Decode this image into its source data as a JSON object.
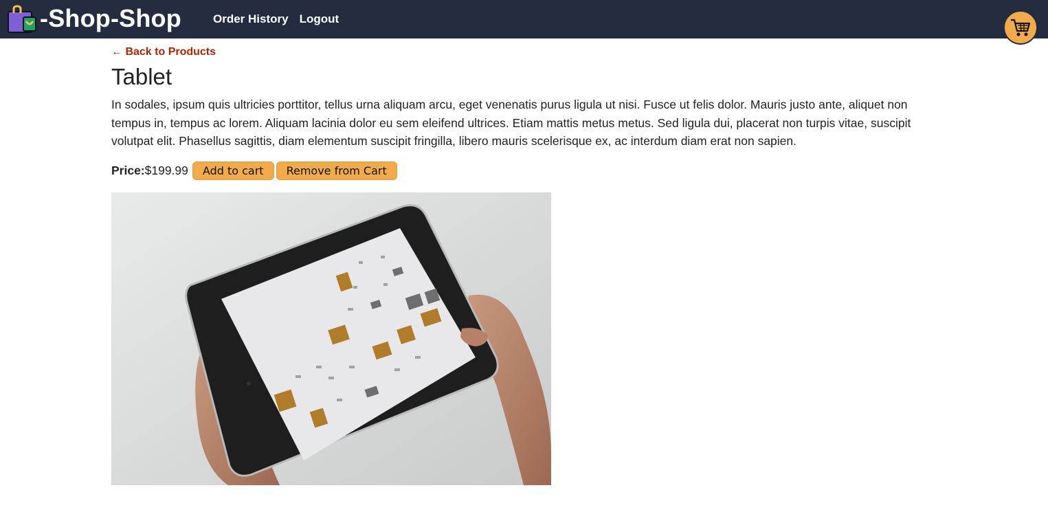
{
  "header": {
    "brand": "-Shop-Shop",
    "nav": [
      {
        "label": "Order History"
      },
      {
        "label": "Logout"
      }
    ],
    "cart_icon": "shopping-cart-icon",
    "logo_icon": "shopping-bag-icon"
  },
  "product": {
    "back_link": "← Back to Products",
    "title": "Tablet",
    "description": "In sodales, ipsum quis ultricies porttitor, tellus urna aliquam arcu, eget venenatis purus ligula ut nisi. Fusce ut felis dolor. Mauris justo ante, aliquet non tempus in, tempus ac lorem. Aliquam lacinia dolor eu sem eleifend ultrices. Etiam mattis metus metus. Sed ligula dui, placerat non turpis vitae, suscipit volutpat elit. Phasellus sagittis, diam elementum suscipit fringilla, libero mauris scelerisque ex, ac interdum diam erat non sapien.",
    "price_label": "Price:",
    "price": "$199.99",
    "add_label": "Add to cart",
    "remove_label": "Remove from Cart"
  },
  "colors": {
    "navbar": "#232d3f",
    "accent": "#f2ab4b",
    "link": "#b52400"
  }
}
